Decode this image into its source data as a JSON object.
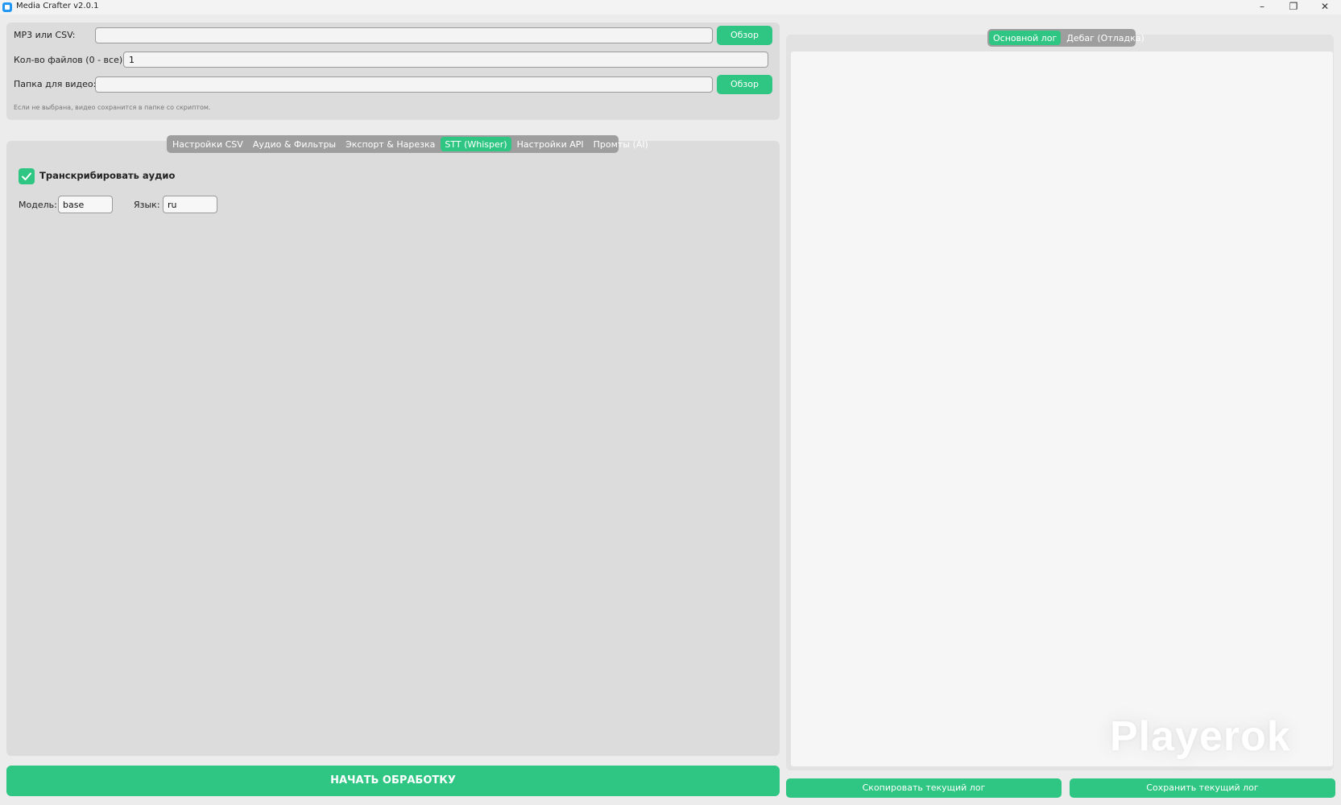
{
  "window": {
    "title": "Media Crafter v2.0.1",
    "controls": [
      "–",
      "❐",
      "✕"
    ]
  },
  "inputs": {
    "mp3_csv": {
      "label": "MP3 или CSV:",
      "value": "",
      "browse": "Обзор"
    },
    "file_count": {
      "label": "Кол-во файлов (0 - все):",
      "value": "1"
    },
    "video_folder": {
      "label": "Папка для видео:",
      "value": "",
      "browse": "Обзор"
    },
    "hint": "Если не выбрана, видео сохранится в папке со скриптом."
  },
  "settings_tabs": [
    {
      "label": "Настройки CSV",
      "active": false
    },
    {
      "label": "Аудио & Фильтры",
      "active": false
    },
    {
      "label": "Экспорт & Нарезка",
      "active": false
    },
    {
      "label": "STT (Whisper)",
      "active": true
    },
    {
      "label": "Настройки API",
      "active": false
    },
    {
      "label": "Промты (AI)",
      "active": false
    }
  ],
  "stt": {
    "transcribe_label": "Транскрибировать аудио",
    "transcribe_checked": true,
    "model_label": "Модель:",
    "model_value": "base",
    "language_label": "Язык:",
    "language_value": "ru"
  },
  "start_button": "НАЧАТЬ ОБРАБОТКУ",
  "log_tabs": [
    {
      "label": "Основной лог",
      "active": true
    },
    {
      "label": "Дебаг (Отладка)",
      "active": false
    }
  ],
  "log_buttons": {
    "copy": "Скопировать текущий лог",
    "save": "Сохранить текущий лог"
  },
  "watermark": "Playerok",
  "colors": {
    "accent": "#2ec682",
    "panel": "#dcdcdc",
    "tab_bar": "#9e9e9e",
    "log_bg": "#f6f6f6"
  }
}
